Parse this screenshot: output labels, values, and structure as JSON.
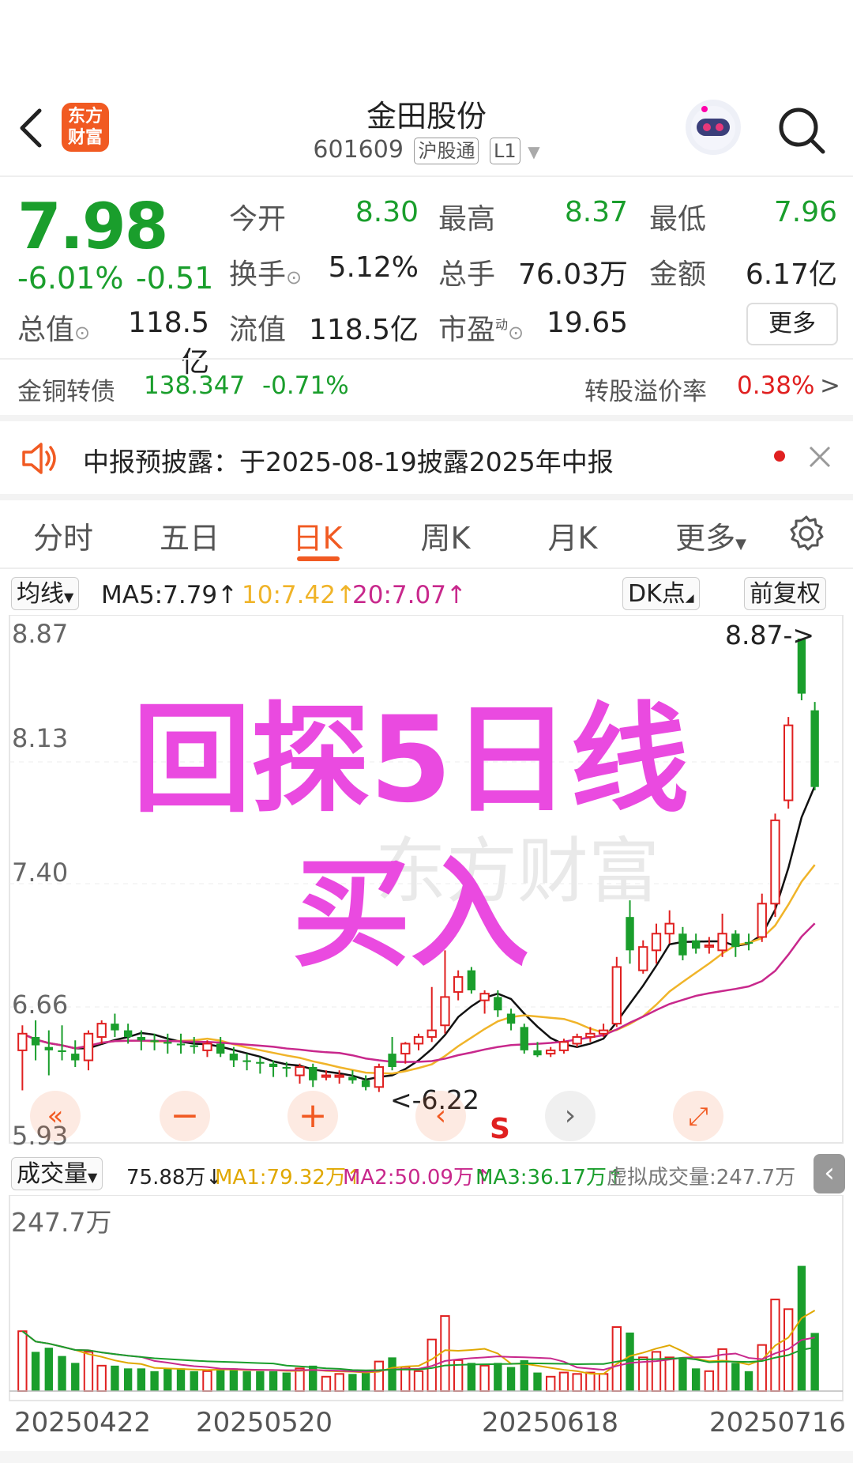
{
  "header": {
    "logo_text_1": "东方",
    "logo_text_2": "财富",
    "stock_name": "金田股份",
    "stock_code": "601609",
    "tag_connect": "沪股通",
    "tag_level": "L1"
  },
  "quote": {
    "price": "7.98",
    "change_pct": "-6.01%",
    "change_amt": "-0.51",
    "open_label": "今开",
    "open_value": "8.30",
    "high_label": "最高",
    "high_value": "8.37",
    "low_label": "最低",
    "low_value": "7.96",
    "turnover_label": "换手",
    "turnover_value": "5.12%",
    "volume_label": "总手",
    "volume_value": "76.03万",
    "amount_label": "金额",
    "amount_value": "6.17亿",
    "mktcap_label": "总值",
    "mktcap_value": "118.5亿",
    "float_label": "流值",
    "float_value": "118.5亿",
    "pe_label": "市盈",
    "pe_sup": "动",
    "pe_value": "19.65",
    "more_label": "更多"
  },
  "bond": {
    "name": "金铜转债",
    "price": "138.347",
    "change": "-0.71%",
    "premium_label": "转股溢价率",
    "premium_value": "0.38%",
    "arrow": ">"
  },
  "notice": {
    "text": "中报预披露：于2025-08-19披露2025年中报"
  },
  "tabs": [
    "分时",
    "五日",
    "日K",
    "周K",
    "月K",
    "更多"
  ],
  "ma_bar": {
    "selector": "均线",
    "ma5": "MA5:7.79",
    "ma10": "10:7.42",
    "ma20": "20:7.07",
    "arrow": "↑",
    "dk_label": "DK点",
    "adjust_label": "前复权"
  },
  "price_axis": [
    "8.87",
    "8.13",
    "7.40",
    "6.66",
    "5.93"
  ],
  "chart_annotations": {
    "high_marker": "8.87->",
    "low_marker": "<-6.22",
    "signal": "S"
  },
  "overlay": {
    "line1": "回探5日线",
    "line2": "买入",
    "watermark": "东方财富"
  },
  "volume_bar": {
    "selector": "成交量",
    "value": "75.88万↓",
    "ma1": "MA1:79.32万↑",
    "ma2": "MA2:50.09万↑",
    "ma3": "MA3:36.17万↑",
    "virtual": "虚拟成交量:247.7万",
    "axis_top": "247.7万"
  },
  "dates": [
    "20250422",
    "20250520",
    "20250618",
    "20250716"
  ],
  "colors": {
    "up": "#e02020",
    "down": "#1a9e2c",
    "accent": "#f15a22",
    "ma5": "#111111",
    "ma10": "#f0b429",
    "ma20": "#c8288c"
  },
  "chart_data": {
    "type": "candlestick",
    "ylim": [
      5.93,
      8.87
    ],
    "candles": [
      {
        "o": 6.4,
        "h": 6.55,
        "l": 6.16,
        "c": 6.5
      },
      {
        "o": 6.48,
        "h": 6.58,
        "l": 6.34,
        "c": 6.43
      },
      {
        "o": 6.42,
        "h": 6.52,
        "l": 6.25,
        "c": 6.4
      },
      {
        "o": 6.4,
        "h": 6.55,
        "l": 6.34,
        "c": 6.39
      },
      {
        "o": 6.38,
        "h": 6.46,
        "l": 6.3,
        "c": 6.34
      },
      {
        "o": 6.34,
        "h": 6.52,
        "l": 6.28,
        "c": 6.5
      },
      {
        "o": 6.48,
        "h": 6.58,
        "l": 6.44,
        "c": 6.56
      },
      {
        "o": 6.56,
        "h": 6.62,
        "l": 6.48,
        "c": 6.52
      },
      {
        "o": 6.52,
        "h": 6.56,
        "l": 6.44,
        "c": 6.48
      },
      {
        "o": 6.48,
        "h": 6.52,
        "l": 6.4,
        "c": 6.46
      },
      {
        "o": 6.46,
        "h": 6.5,
        "l": 6.4,
        "c": 6.45
      },
      {
        "o": 6.45,
        "h": 6.5,
        "l": 6.38,
        "c": 6.44
      },
      {
        "o": 6.44,
        "h": 6.5,
        "l": 6.38,
        "c": 6.43
      },
      {
        "o": 6.43,
        "h": 6.48,
        "l": 6.38,
        "c": 6.42
      },
      {
        "o": 6.4,
        "h": 6.46,
        "l": 6.36,
        "c": 6.44
      },
      {
        "o": 6.44,
        "h": 6.48,
        "l": 6.36,
        "c": 6.38
      },
      {
        "o": 6.38,
        "h": 6.42,
        "l": 6.3,
        "c": 6.34
      },
      {
        "o": 6.34,
        "h": 6.38,
        "l": 6.28,
        "c": 6.33
      },
      {
        "o": 6.33,
        "h": 6.36,
        "l": 6.26,
        "c": 6.32
      },
      {
        "o": 6.32,
        "h": 6.34,
        "l": 6.24,
        "c": 6.3
      },
      {
        "o": 6.3,
        "h": 6.33,
        "l": 6.24,
        "c": 6.29
      },
      {
        "o": 6.25,
        "h": 6.32,
        "l": 6.2,
        "c": 6.3
      },
      {
        "o": 6.3,
        "h": 6.32,
        "l": 6.18,
        "c": 6.22
      },
      {
        "o": 6.24,
        "h": 6.28,
        "l": 6.22,
        "c": 6.25
      },
      {
        "o": 6.24,
        "h": 6.28,
        "l": 6.2,
        "c": 6.25
      },
      {
        "o": 6.24,
        "h": 6.28,
        "l": 6.2,
        "c": 6.22
      },
      {
        "o": 6.22,
        "h": 6.25,
        "l": 6.16,
        "c": 6.18
      },
      {
        "o": 6.18,
        "h": 6.32,
        "l": 6.15,
        "c": 6.3
      },
      {
        "o": 6.38,
        "h": 6.48,
        "l": 6.28,
        "c": 6.3
      },
      {
        "o": 6.38,
        "h": 6.45,
        "l": 6.32,
        "c": 6.44
      },
      {
        "o": 6.44,
        "h": 6.5,
        "l": 6.4,
        "c": 6.48
      },
      {
        "o": 6.48,
        "h": 6.78,
        "l": 6.45,
        "c": 6.52
      },
      {
        "o": 6.55,
        "h": 7.0,
        "l": 6.5,
        "c": 6.72
      },
      {
        "o": 6.75,
        "h": 6.88,
        "l": 6.7,
        "c": 6.84
      },
      {
        "o": 6.88,
        "h": 6.9,
        "l": 6.74,
        "c": 6.76
      },
      {
        "o": 6.7,
        "h": 6.76,
        "l": 6.62,
        "c": 6.74
      },
      {
        "o": 6.72,
        "h": 6.76,
        "l": 6.6,
        "c": 6.64
      },
      {
        "o": 6.62,
        "h": 6.65,
        "l": 6.52,
        "c": 6.56
      },
      {
        "o": 6.54,
        "h": 6.56,
        "l": 6.38,
        "c": 6.4
      },
      {
        "o": 6.4,
        "h": 6.45,
        "l": 6.36,
        "c": 6.37
      },
      {
        "o": 6.38,
        "h": 6.42,
        "l": 6.36,
        "c": 6.4
      },
      {
        "o": 6.4,
        "h": 6.47,
        "l": 6.38,
        "c": 6.45
      },
      {
        "o": 6.44,
        "h": 6.5,
        "l": 6.42,
        "c": 6.48
      },
      {
        "o": 6.48,
        "h": 6.54,
        "l": 6.45,
        "c": 6.5
      },
      {
        "o": 6.5,
        "h": 6.56,
        "l": 6.48,
        "c": 6.52
      },
      {
        "o": 6.56,
        "h": 6.96,
        "l": 6.54,
        "c": 6.9
      },
      {
        "o": 7.2,
        "h": 7.3,
        "l": 6.92,
        "c": 7.0
      },
      {
        "o": 6.88,
        "h": 7.06,
        "l": 6.86,
        "c": 7.02
      },
      {
        "o": 7.0,
        "h": 7.16,
        "l": 6.92,
        "c": 7.1
      },
      {
        "o": 7.1,
        "h": 7.24,
        "l": 7.04,
        "c": 7.16
      },
      {
        "o": 7.1,
        "h": 7.14,
        "l": 6.94,
        "c": 6.97
      },
      {
        "o": 7.06,
        "h": 7.1,
        "l": 6.98,
        "c": 7.01
      },
      {
        "o": 7.02,
        "h": 7.08,
        "l": 6.98,
        "c": 7.03
      },
      {
        "o": 7.0,
        "h": 7.22,
        "l": 6.96,
        "c": 7.1
      },
      {
        "o": 7.1,
        "h": 7.12,
        "l": 6.96,
        "c": 7.02
      },
      {
        "o": 7.05,
        "h": 7.1,
        "l": 7.0,
        "c": 7.04
      },
      {
        "o": 7.08,
        "h": 7.34,
        "l": 7.05,
        "c": 7.28
      },
      {
        "o": 7.28,
        "h": 7.82,
        "l": 7.2,
        "c": 7.78
      },
      {
        "o": 7.9,
        "h": 8.4,
        "l": 7.85,
        "c": 8.35
      },
      {
        "o": 8.87,
        "h": 8.87,
        "l": 8.5,
        "c": 8.54
      },
      {
        "o": 8.44,
        "h": 8.49,
        "l": 7.96,
        "c": 7.98
      }
    ],
    "ma5_end": 7.79,
    "ma10_end": 7.42,
    "ma20_end": 7.07,
    "volume_max_wan": 247.7,
    "volume_last_wan": 75.88
  }
}
